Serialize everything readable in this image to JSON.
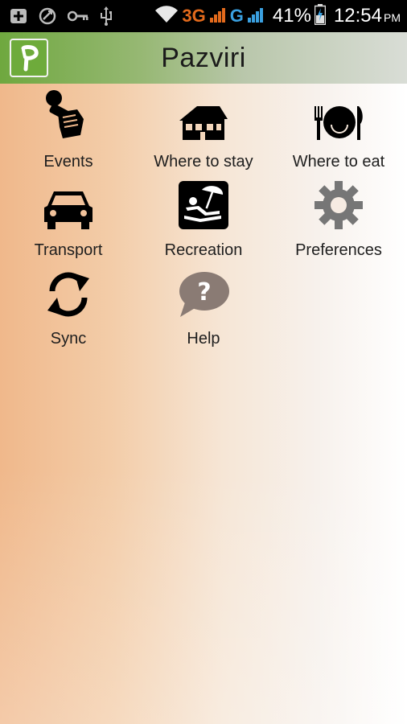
{
  "status_bar": {
    "icons": [
      "add-notification-icon",
      "sync-status-icon",
      "key-icon",
      "usb-icon",
      "wifi-icon"
    ],
    "network_type_1": "3G",
    "network_type_2": "G",
    "battery_percent": "41%",
    "time": "12:54",
    "ampm": "PM",
    "accent_color": "#e36a1c"
  },
  "app_bar": {
    "title": "Pazviri",
    "logo_letter": "P",
    "logo_color": "#6eab3b"
  },
  "menu": {
    "items": [
      {
        "label": "Events",
        "icon": "microphone-fist-icon"
      },
      {
        "label": "Where to stay",
        "icon": "house-icon"
      },
      {
        "label": "Where to eat",
        "icon": "plate-cutlery-icon"
      },
      {
        "label": "Transport",
        "icon": "car-icon"
      },
      {
        "label": "Recreation",
        "icon": "beach-chair-icon"
      },
      {
        "label": "Preferences",
        "icon": "gear-icon"
      },
      {
        "label": "Sync",
        "icon": "sync-arrows-icon"
      },
      {
        "label": "Help",
        "icon": "help-bubble-icon"
      }
    ]
  }
}
